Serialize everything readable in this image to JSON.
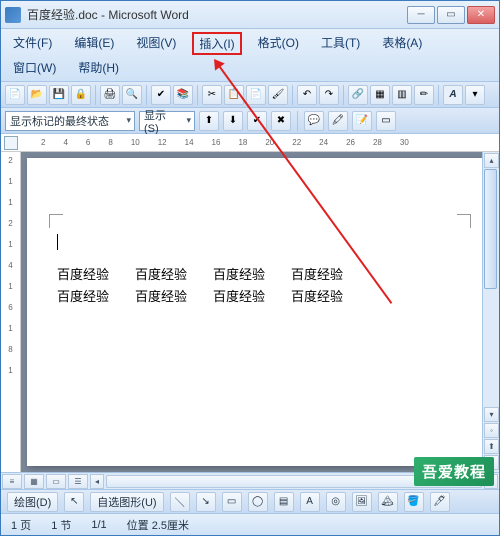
{
  "titlebar": {
    "title": "百度经验.doc - Microsoft Word"
  },
  "menu": {
    "file": "文件(F)",
    "edit": "编辑(E)",
    "view": "视图(V)",
    "insert": "插入(I)",
    "format": "格式(O)",
    "tools": "工具(T)",
    "table": "表格(A)",
    "window": "窗口(W)",
    "help": "帮助(H)"
  },
  "toolbar2": {
    "combo1": "显示标记的最终状态",
    "show": "显示(S)"
  },
  "ruler": {
    "marks": [
      "2",
      "4",
      "6",
      "8",
      "10",
      "12",
      "14",
      "16",
      "18",
      "20",
      "22",
      "24",
      "26",
      "28",
      "30"
    ]
  },
  "vruler": {
    "marks": [
      "2",
      "1",
      "1",
      "2",
      "1",
      "4",
      "1",
      "6",
      "1",
      "8",
      "1"
    ]
  },
  "document": {
    "cell": "百度经验",
    "rows": [
      [
        "百度经验",
        "百度经验",
        "百度经验",
        "百度经验"
      ],
      [
        "百度经验",
        "百度经验",
        "百度经验",
        "百度经验"
      ]
    ]
  },
  "bottombar": {
    "draw": "绘图(D)",
    "autoshape": "自选图形(U)"
  },
  "status": {
    "page": "1 页",
    "section": "1 节",
    "pos": "1/1",
    "location": "位置 2.5厘米"
  },
  "watermark": "吾爱教程",
  "colors": {
    "highlight": "#e02020",
    "chrome": "#cfe2f6"
  }
}
